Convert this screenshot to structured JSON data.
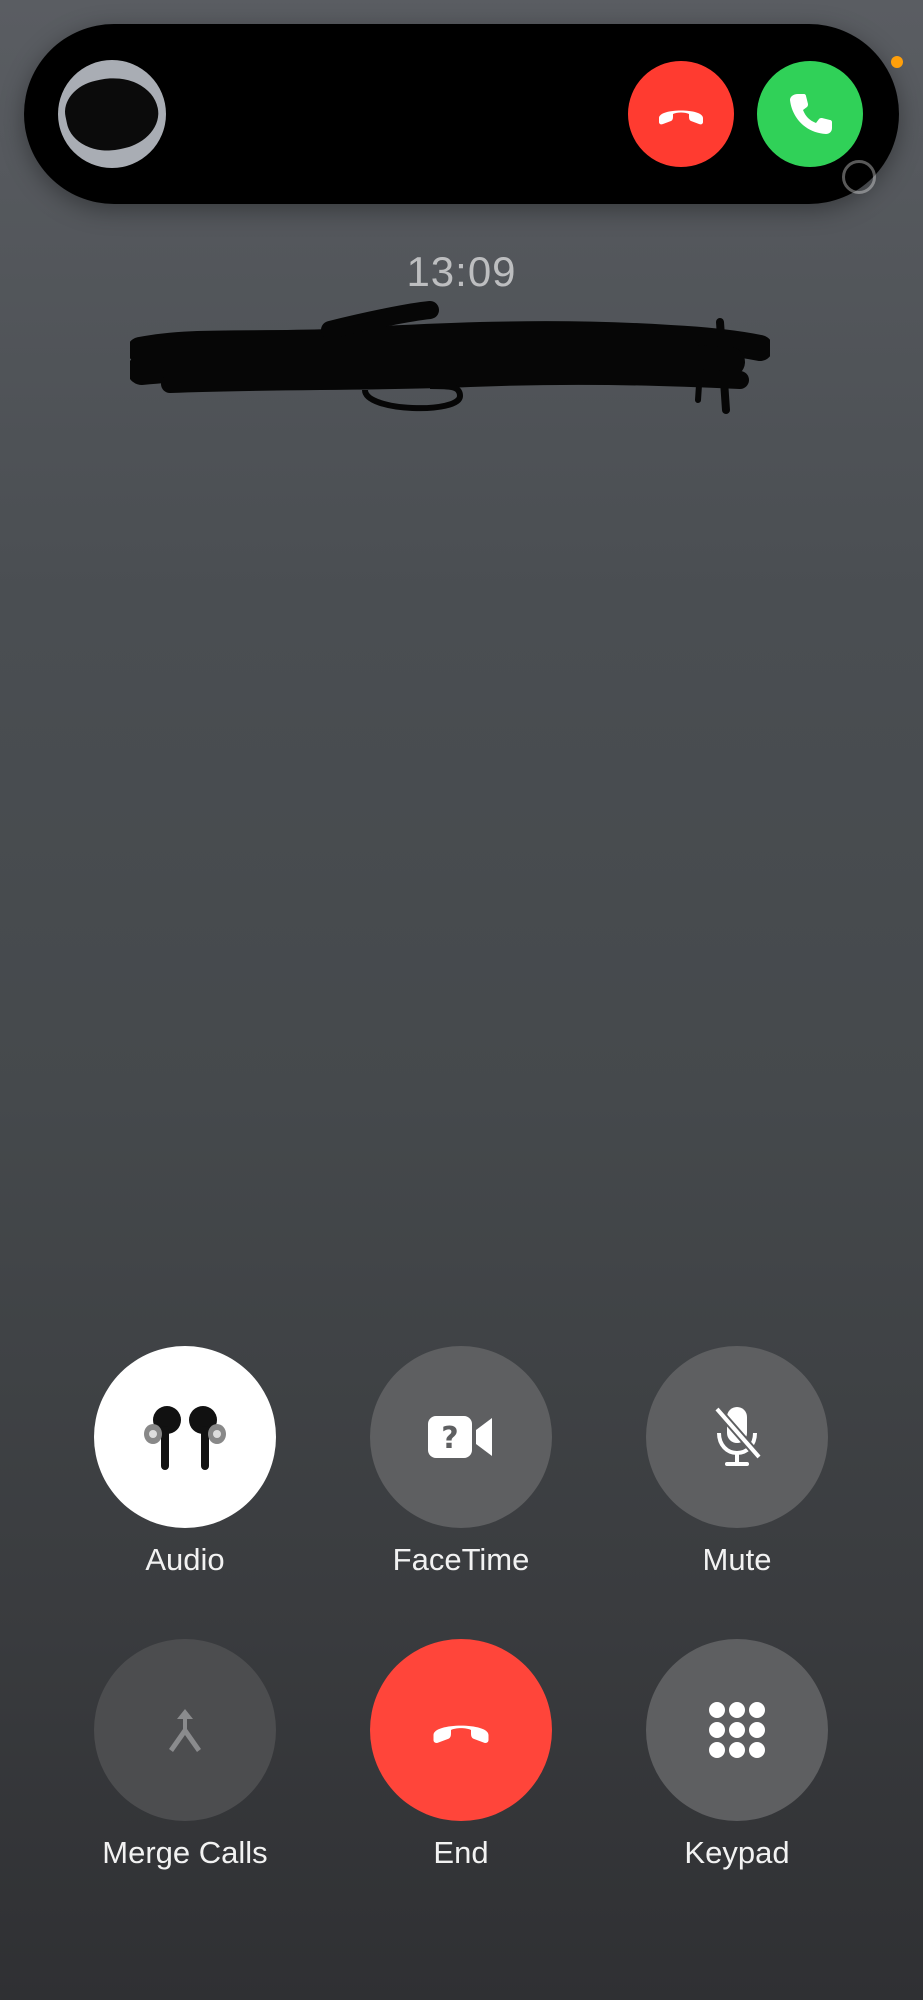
{
  "banner": {
    "caller_name": "",
    "decline_label": "Decline",
    "accept_label": "Accept"
  },
  "call": {
    "time": "13:09"
  },
  "controls": {
    "audio": "Audio",
    "facetime": "FaceTime",
    "mute": "Mute",
    "merge_calls": "Merge Calls",
    "end": "End",
    "keypad": "Keypad"
  },
  "colors": {
    "decline_red": "#ff3b30",
    "accept_green": "#30d158",
    "end_red": "#ff453a",
    "privacy_dot_orange": "#ff9f0a"
  }
}
